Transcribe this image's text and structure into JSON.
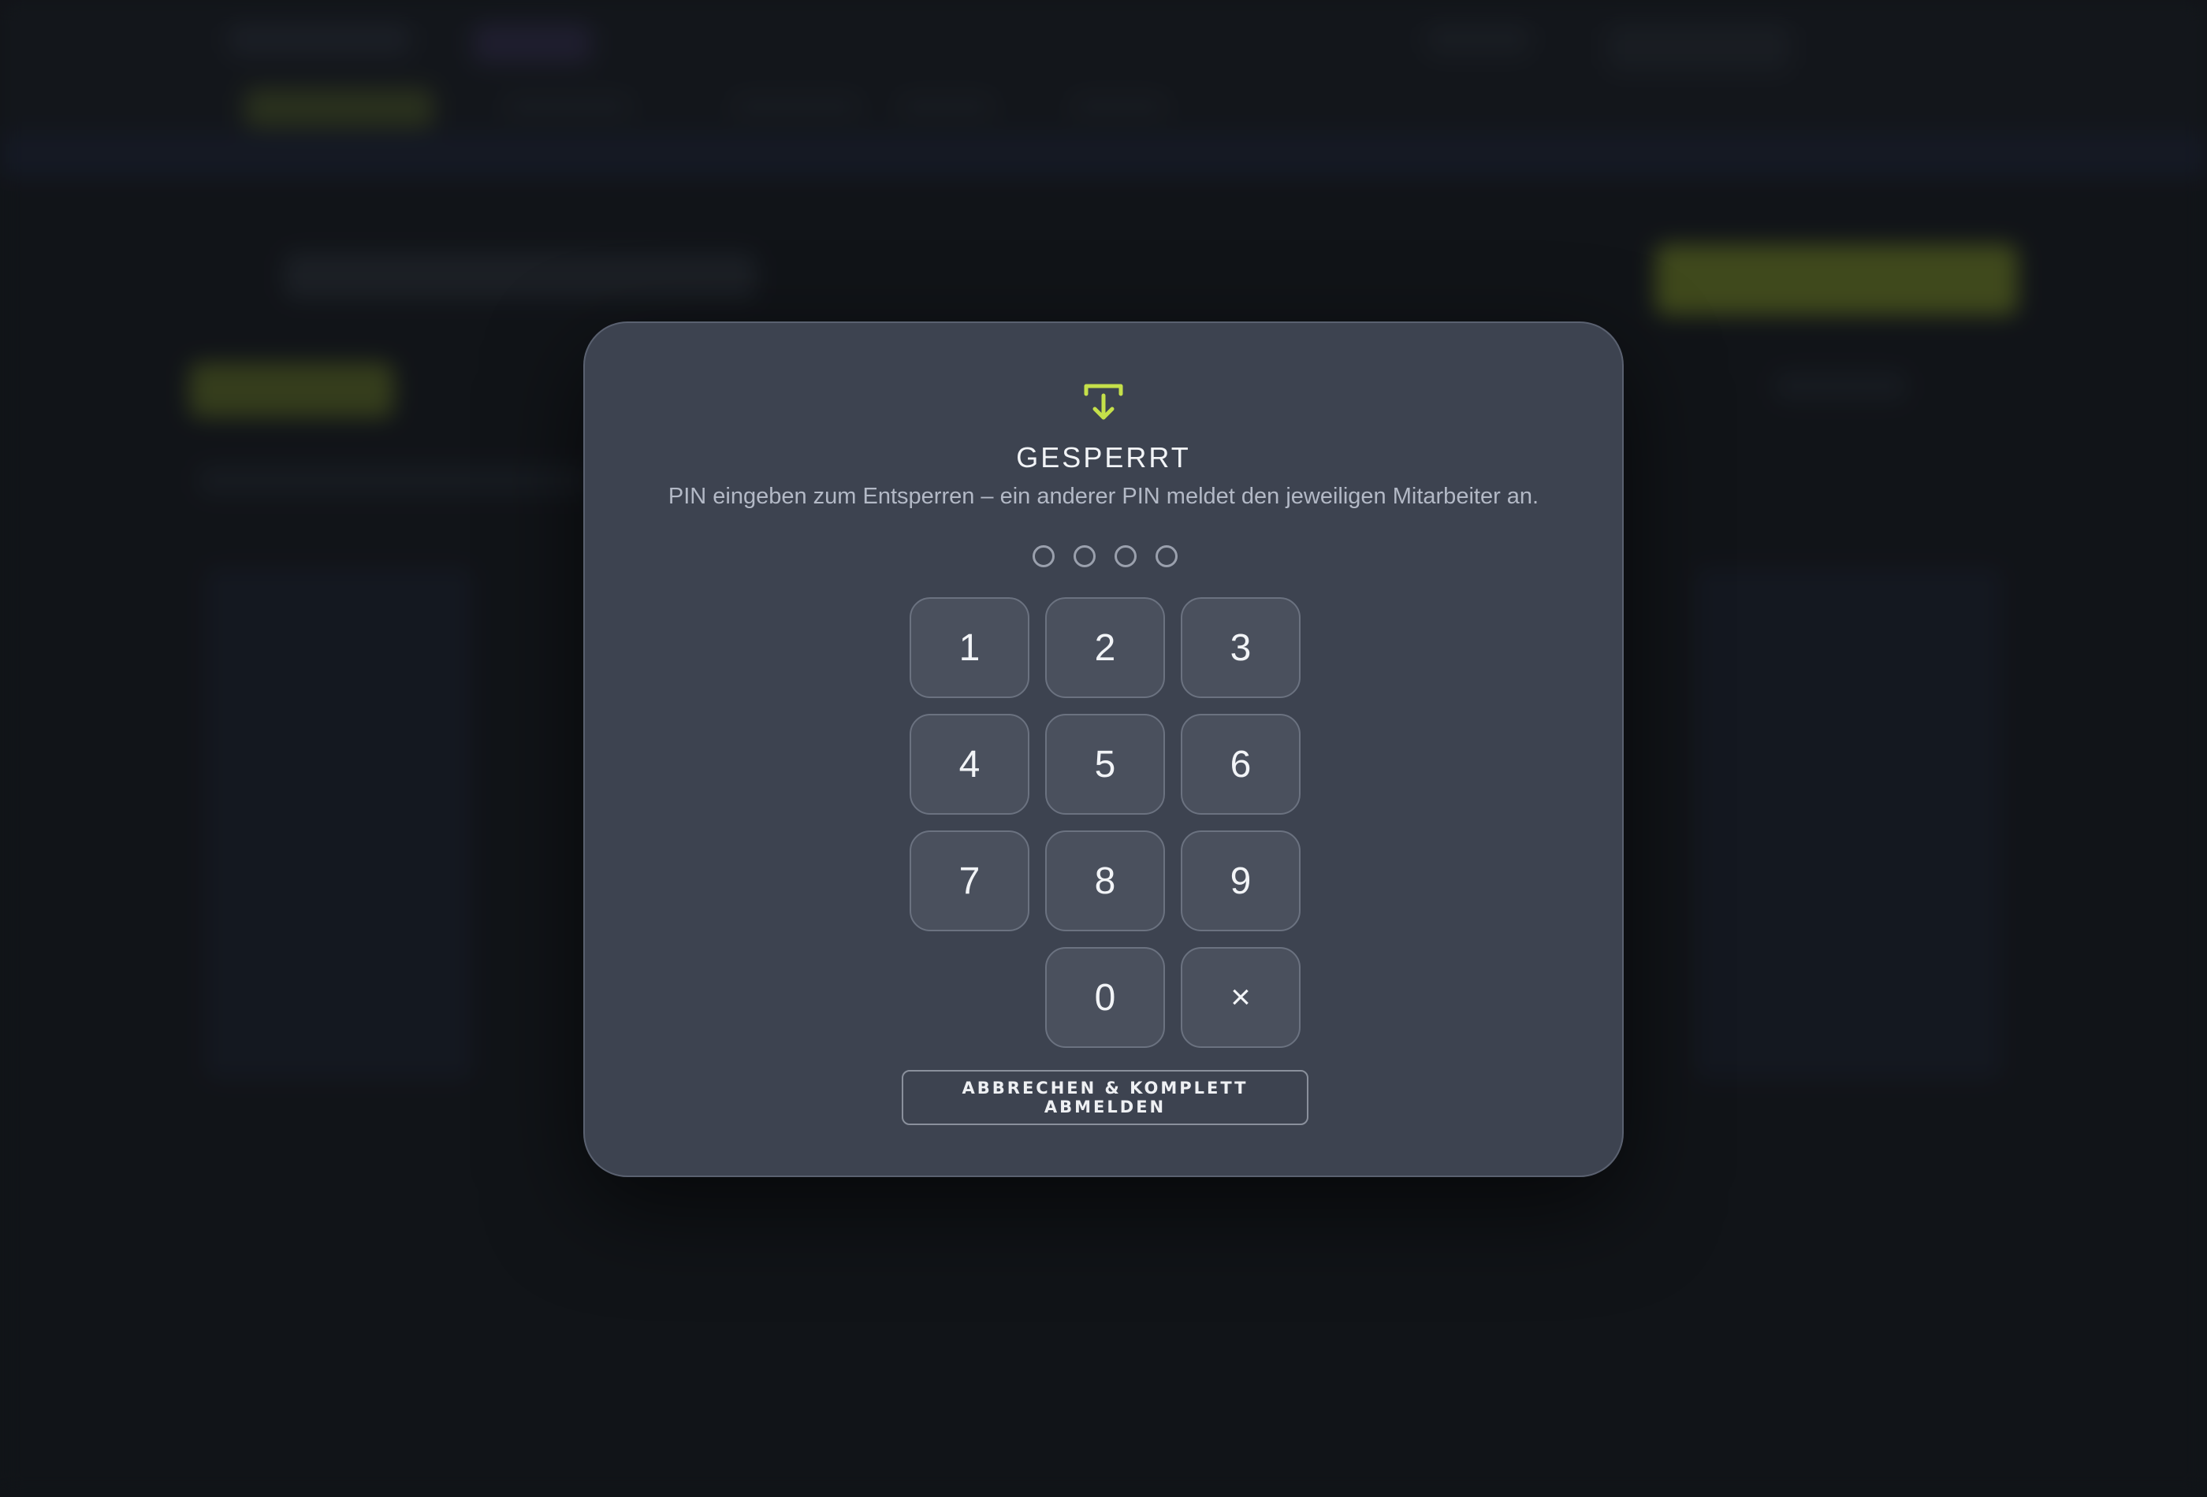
{
  "lock_screen": {
    "icon": "download-arrow-icon",
    "title": "GESPERRT",
    "subtitle": "PIN eingeben zum Entsperren – ein anderer PIN meldet den jeweiligen Mitarbeiter an.",
    "pin_length": 4,
    "pin_entered": 0,
    "keys": {
      "k1": "1",
      "k2": "2",
      "k3": "3",
      "k4": "4",
      "k5": "5",
      "k6": "6",
      "k7": "7",
      "k8": "8",
      "k9": "9",
      "k0": "0",
      "delete": "×"
    },
    "logout_label": "ABBRECHEN & KOMPLETT ABMELDEN"
  },
  "colors": {
    "accent": "#c5e04a",
    "dialog_bg": "#3d4350",
    "key_bg": "#4a505d",
    "page_bg": "#16191e"
  }
}
